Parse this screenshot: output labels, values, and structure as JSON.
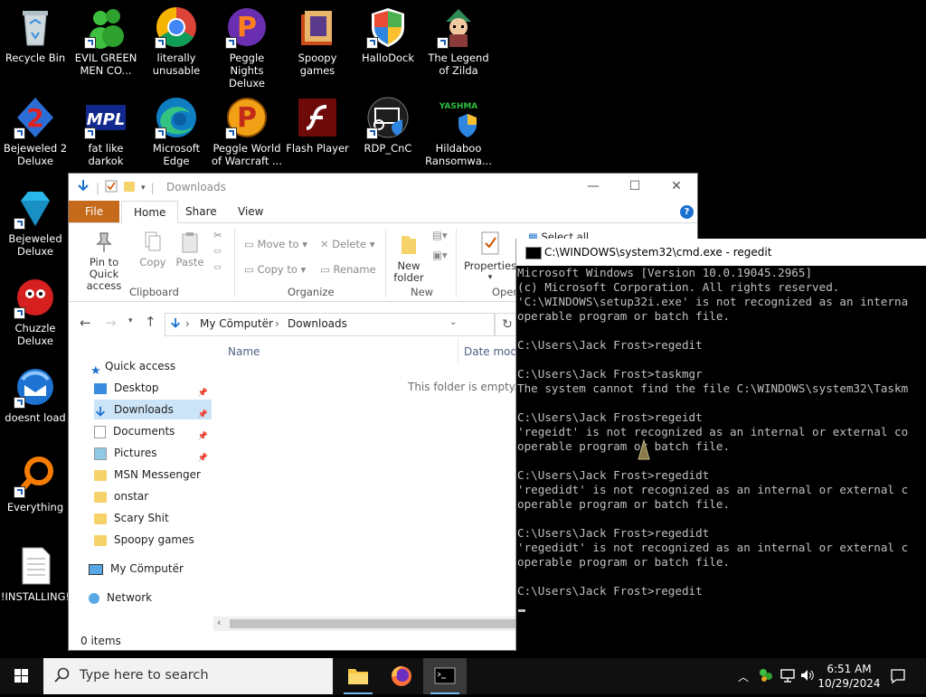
{
  "desktop": {
    "icons": [
      {
        "label": "Recycle Bin"
      },
      {
        "label": "EVIL GREEN MEN CO..."
      },
      {
        "label": "literally unusable"
      },
      {
        "label": "Peggle Nights Deluxe"
      },
      {
        "label": "Spoopy games"
      },
      {
        "label": "HalloDock"
      },
      {
        "label": "The Legend of Zilda"
      },
      {
        "label": "Bejeweled 2 Deluxe"
      },
      {
        "label": "fat like darkok"
      },
      {
        "label": "Microsoft Edge"
      },
      {
        "label": "Peggle World of Warcraft ..."
      },
      {
        "label": "Flash Player"
      },
      {
        "label": "RDP_CnC"
      },
      {
        "label": "Hildaboo Ransomwa..."
      },
      {
        "label": "Bejeweled Deluxe"
      },
      {
        "label": "Chuzzle Deluxe"
      },
      {
        "label": "doesnt load"
      },
      {
        "label": "Everything"
      },
      {
        "label": "!INSTALLING!"
      }
    ],
    "icon_glyph_texts": {
      "mpl": "MPL",
      "yashma": "YASHMA"
    }
  },
  "explorer": {
    "title": "Downloads",
    "window_buttons": {
      "minimize": "—",
      "maximize": "☐",
      "close": "✕"
    },
    "tabs": {
      "file": "File",
      "home": "Home",
      "share": "Share",
      "view": "View"
    },
    "ribbon": {
      "pin": "Pin to Quick access",
      "copy": "Copy",
      "paste": "Paste",
      "move_to": "Move to",
      "copy_to": "Copy to",
      "delete": "Delete",
      "rename": "Rename",
      "new_folder": "New folder",
      "properties": "Properties",
      "select_all": "Select all",
      "groups": {
        "clipboard": "Clipboard",
        "organize": "Organize",
        "new": "New",
        "open": "Open"
      }
    },
    "address": {
      "root": "My Cömputër",
      "current": "Downloads",
      "separator": "›"
    },
    "nav": [
      {
        "label": "Quick access"
      },
      {
        "label": "Desktop"
      },
      {
        "label": "Downloads"
      },
      {
        "label": "Documents"
      },
      {
        "label": "Pictures"
      },
      {
        "label": "MSN Messenger"
      },
      {
        "label": "onstar"
      },
      {
        "label": "Scary Shit"
      },
      {
        "label": "Spoopy games"
      },
      {
        "label": "My Cömputër"
      },
      {
        "label": "Network"
      }
    ],
    "columns": {
      "name": "Name",
      "date": "Date modifi"
    },
    "empty_message": "This folder is empty.",
    "status": "0 items"
  },
  "cmd": {
    "title": "C:\\WINDOWS\\system32\\cmd.exe - regedit",
    "lines": [
      "Microsoft Windows [Version 10.0.19045.2965]",
      "(c) Microsoft Corporation. All rights reserved.",
      "'C:\\WINDOWS\\setup32i.exe' is not recognized as an interna",
      "operable program or batch file.",
      "",
      "C:\\Users\\Jack Frost>regedit",
      "",
      "C:\\Users\\Jack Frost>taskmgr",
      "The system cannot find the file C:\\WINDOWS\\system32\\Taskm",
      "",
      "C:\\Users\\Jack Frost>regeidt",
      "'regeidt' is not recognized as an internal or external co",
      "operable program or batch file.",
      "",
      "C:\\Users\\Jack Frost>regedidt",
      "'regedidt' is not recognized as an internal or external c",
      "operable program or batch file.",
      "",
      "C:\\Users\\Jack Frost>regedidt",
      "'regedidt' is not recognized as an internal or external c",
      "operable program or batch file.",
      "",
      "C:\\Users\\Jack Frost>regedit"
    ]
  },
  "taskbar": {
    "search_placeholder": "Type here to search",
    "time": "6:51 AM",
    "date": "10/29/2024"
  }
}
